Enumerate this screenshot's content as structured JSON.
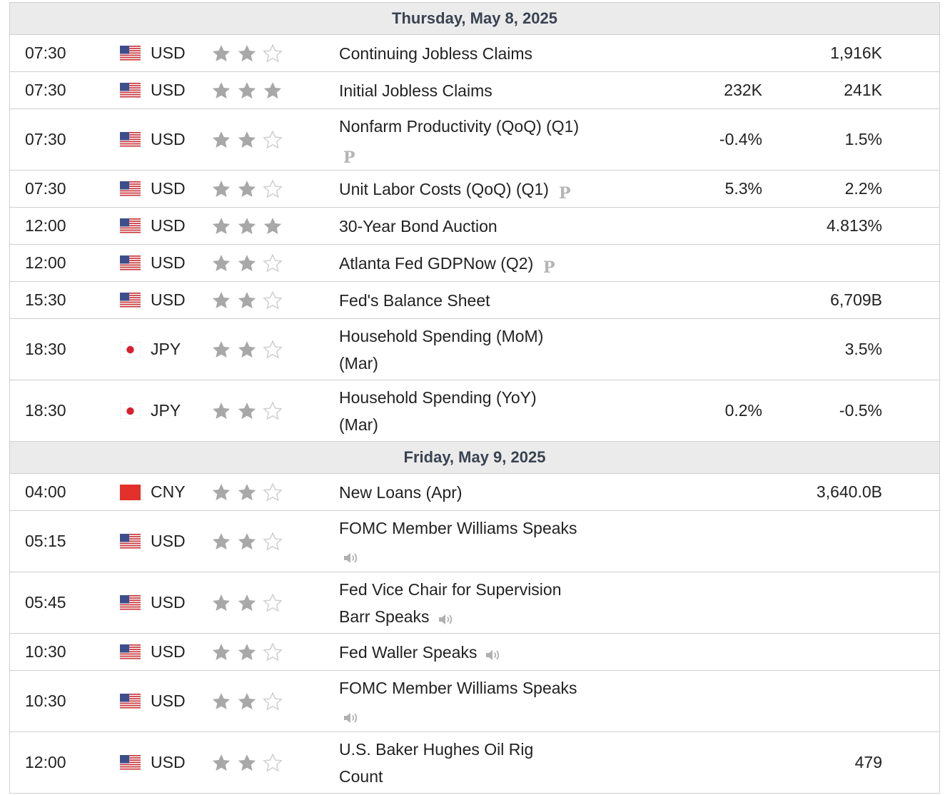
{
  "days": [
    {
      "label": "Thursday, May 8, 2025",
      "events": [
        {
          "time": "07:30",
          "currency": "USD",
          "flag": "us",
          "stars": 2,
          "event_lines": [
            "Continuing Jobless Claims"
          ],
          "badge": "",
          "badge_newline": false,
          "actual": "",
          "previous": "1,916K"
        },
        {
          "time": "07:30",
          "currency": "USD",
          "flag": "us",
          "stars": 3,
          "event_lines": [
            "Initial Jobless Claims"
          ],
          "badge": "",
          "badge_newline": false,
          "actual": "232K",
          "previous": "241K"
        },
        {
          "time": "07:30",
          "currency": "USD",
          "flag": "us",
          "stars": 2,
          "event_lines": [
            "Nonfarm Productivity (QoQ) (Q1)"
          ],
          "badge": "preliminary",
          "badge_newline": true,
          "actual": "-0.4%",
          "previous": "1.5%"
        },
        {
          "time": "07:30",
          "currency": "USD",
          "flag": "us",
          "stars": 2,
          "event_lines": [
            "Unit Labor Costs (QoQ) (Q1)"
          ],
          "badge": "preliminary",
          "badge_newline": false,
          "actual": "5.3%",
          "previous": "2.2%"
        },
        {
          "time": "12:00",
          "currency": "USD",
          "flag": "us",
          "stars": 3,
          "event_lines": [
            "30-Year Bond Auction"
          ],
          "badge": "",
          "badge_newline": false,
          "actual": "",
          "previous": "4.813%"
        },
        {
          "time": "12:00",
          "currency": "USD",
          "flag": "us",
          "stars": 2,
          "event_lines": [
            "Atlanta Fed GDPNow (Q2)"
          ],
          "badge": "preliminary",
          "badge_newline": false,
          "actual": "",
          "previous": ""
        },
        {
          "time": "15:30",
          "currency": "USD",
          "flag": "us",
          "stars": 2,
          "event_lines": [
            "Fed's Balance Sheet"
          ],
          "badge": "",
          "badge_newline": false,
          "actual": "",
          "previous": "6,709B"
        },
        {
          "time": "18:30",
          "currency": "JPY",
          "flag": "jp",
          "stars": 2,
          "event_lines": [
            "Household Spending (MoM)",
            "(Mar)"
          ],
          "badge": "",
          "badge_newline": false,
          "actual": "",
          "previous": "3.5%"
        },
        {
          "time": "18:30",
          "currency": "JPY",
          "flag": "jp",
          "stars": 2,
          "event_lines": [
            "Household Spending (YoY)",
            "(Mar)"
          ],
          "badge": "",
          "badge_newline": false,
          "actual": "0.2%",
          "previous": "-0.5%"
        }
      ]
    },
    {
      "label": "Friday, May 9, 2025",
      "events": [
        {
          "time": "04:00",
          "currency": "CNY",
          "flag": "cn",
          "stars": 2,
          "event_lines": [
            "New Loans (Apr)"
          ],
          "badge": "",
          "badge_newline": false,
          "actual": "",
          "previous": "3,640.0B"
        },
        {
          "time": "05:15",
          "currency": "USD",
          "flag": "us",
          "stars": 2,
          "event_lines": [
            "FOMC Member Williams Speaks"
          ],
          "badge": "speech",
          "badge_newline": true,
          "actual": "",
          "previous": ""
        },
        {
          "time": "05:45",
          "currency": "USD",
          "flag": "us",
          "stars": 2,
          "event_lines": [
            "Fed Vice Chair for Supervision",
            "Barr Speaks"
          ],
          "badge": "speech",
          "badge_newline": false,
          "actual": "",
          "previous": ""
        },
        {
          "time": "10:30",
          "currency": "USD",
          "flag": "us",
          "stars": 2,
          "event_lines": [
            "Fed Waller Speaks"
          ],
          "badge": "speech",
          "badge_newline": false,
          "actual": "",
          "previous": ""
        },
        {
          "time": "10:30",
          "currency": "USD",
          "flag": "us",
          "stars": 2,
          "event_lines": [
            "FOMC Member Williams Speaks"
          ],
          "badge": "speech",
          "badge_newline": true,
          "actual": "",
          "previous": ""
        },
        {
          "time": "12:00",
          "currency": "USD",
          "flag": "us",
          "stars": 2,
          "event_lines": [
            "U.S. Baker Hughes Oil Rig",
            "Count"
          ],
          "badge": "",
          "badge_newline": false,
          "actual": "",
          "previous": "479"
        }
      ]
    }
  ],
  "colors": {
    "star_filled": "#a8a8a8",
    "star_empty": "#cfcfcf",
    "header_bg": "#ebebeb",
    "border": "#cfcfcf"
  },
  "icons": {
    "preliminary": "preliminary-p-icon",
    "speech": "speaker-icon"
  }
}
